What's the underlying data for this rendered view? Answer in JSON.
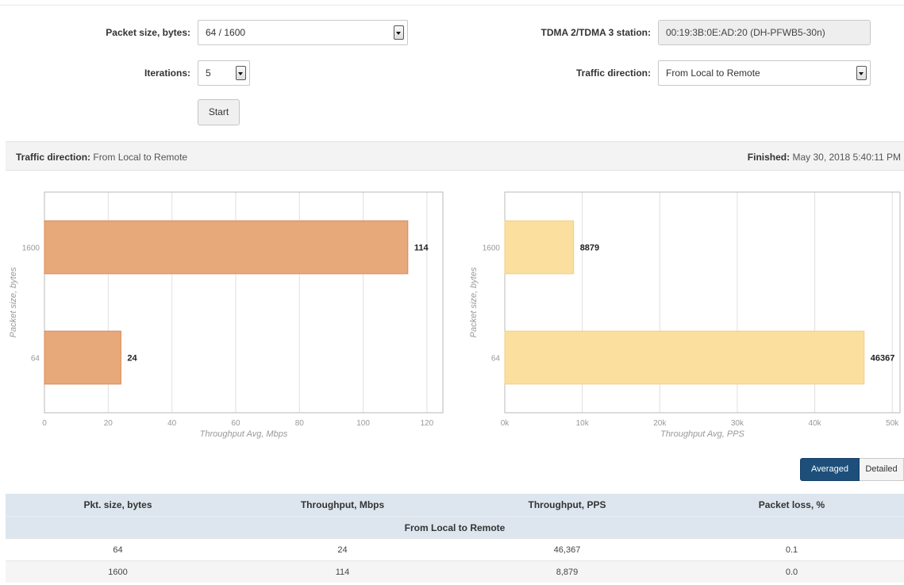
{
  "form": {
    "packet_size_label": "Packet size, bytes:",
    "packet_size_value": "64 / 1600",
    "iterations_label": "Iterations:",
    "iterations_value": "5",
    "start_label": "Start",
    "station_label": "TDMA 2/TDMA 3 station:",
    "station_value": "00:19:3B:0E:AD:20 (DH-PFWB5-30n)",
    "direction_label": "Traffic direction:",
    "direction_value": "From Local to Remote"
  },
  "info": {
    "direction_label": "Traffic direction:",
    "direction_value": "From Local to Remote",
    "finished_label": "Finished:",
    "finished_value": "May 30, 2018 5:40:11 PM"
  },
  "colors": {
    "mbps_bar": "#e8a97a",
    "mbps_bar_stroke": "#d9895a",
    "pps_bar": "#fadf9e",
    "pps_bar_stroke": "#f1cf86",
    "accent": "#1d4f7a"
  },
  "chart_data": [
    {
      "type": "bar",
      "orientation": "horizontal",
      "categories": [
        "1600",
        "64"
      ],
      "values": [
        114,
        24
      ],
      "data_labels": [
        "114",
        "24"
      ],
      "xlabel": "Throughput Avg, Mbps",
      "ylabel": "Packet size, bytes",
      "xlim": [
        0,
        125
      ],
      "xticks": [
        0,
        20,
        40,
        60,
        80,
        100,
        120
      ],
      "xtick_labels": [
        "0",
        "20",
        "40",
        "60",
        "80",
        "100",
        "120"
      ],
      "grid": true
    },
    {
      "type": "bar",
      "orientation": "horizontal",
      "categories": [
        "1600",
        "64"
      ],
      "values": [
        8879,
        46367
      ],
      "data_labels": [
        "8879",
        "46367"
      ],
      "xlabel": "Throughput Avg, PPS",
      "ylabel": "Packet size, bytes",
      "xlim": [
        0,
        51000
      ],
      "xticks": [
        0,
        10000,
        20000,
        30000,
        40000,
        50000
      ],
      "xtick_labels": [
        "0k",
        "10k",
        "20k",
        "30k",
        "40k",
        "50k"
      ],
      "grid": true
    }
  ],
  "view_toggle": {
    "averaged": "Averaged",
    "detailed": "Detailed"
  },
  "table": {
    "headers": [
      "Pkt. size, bytes",
      "Throughput, Mbps",
      "Throughput, PPS",
      "Packet loss, %"
    ],
    "group": "From Local to Remote",
    "rows": [
      [
        "64",
        "24",
        "46,367",
        "0.1"
      ],
      [
        "1600",
        "114",
        "8,879",
        "0.0"
      ]
    ]
  }
}
